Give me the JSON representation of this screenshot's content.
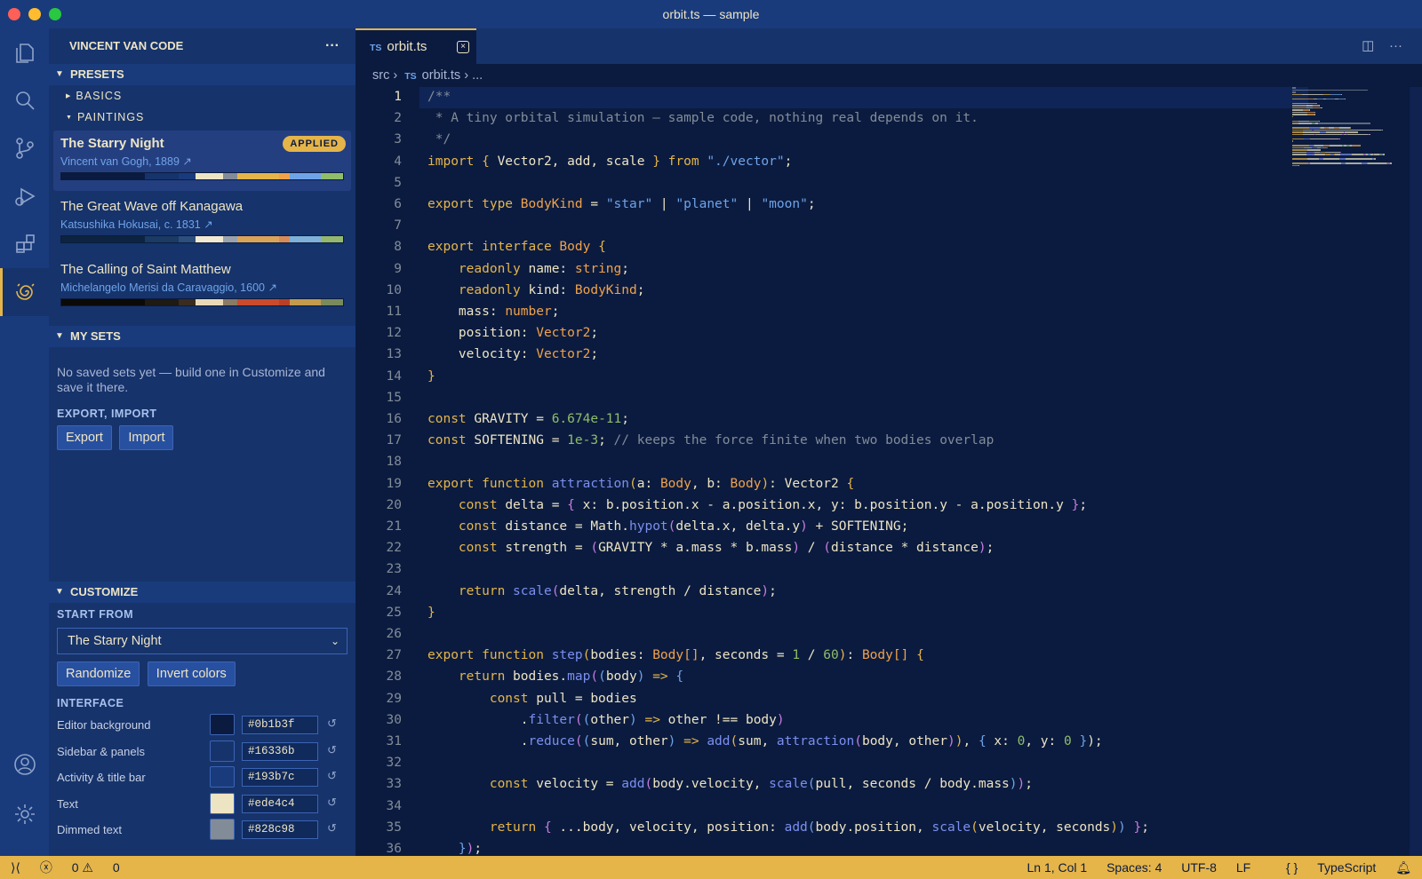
{
  "window": {
    "title": "orbit.ts — sample"
  },
  "sidebar": {
    "title": "VINCENT VAN CODE",
    "presets_label": "PRESETS",
    "basics_label": "BASICS",
    "paintings_label": "PAINTINGS",
    "paintings": [
      {
        "title": "The Starry Night",
        "artist": "Vincent van Gogh, 1889 ↗",
        "badge": "APPLIED",
        "colors": [
          "#0b1b3f",
          "#16336b",
          "#193b7c",
          "#ede4c4",
          "#828c98",
          "#e5b54a",
          "#f0a24a",
          "#6fa3e8",
          "#8fbd6a"
        ]
      },
      {
        "title": "The Great Wave off Kanagawa",
        "artist": "Katsushika Hokusai, c. 1831 ↗",
        "colors": [
          "#0d2440",
          "#1b3a64",
          "#2c4f7e",
          "#f1e9d2",
          "#9aa3ad",
          "#d9a35a",
          "#d88b5a",
          "#7fb0d8",
          "#94b86e"
        ]
      },
      {
        "title": "The Calling of Saint Matthew",
        "artist": "Michelangelo Merisi da Caravaggio, 1600 ↗",
        "colors": [
          "#0c0a08",
          "#1e1a14",
          "#3a2c1e",
          "#ead9b6",
          "#8a7b66",
          "#c94a2c",
          "#b84028",
          "#c49a4c",
          "#7a8a5c"
        ]
      }
    ],
    "mysets_label": "MY SETS",
    "mysets_empty": "No saved sets yet — build one in Customize and save it there.",
    "export_import_label": "EXPORT, IMPORT",
    "export_btn": "Export",
    "import_btn": "Import",
    "customize_label": "CUSTOMIZE",
    "start_from_label": "START FROM",
    "start_from_value": "The Starry Night",
    "randomize_btn": "Randomize",
    "invert_btn": "Invert colors",
    "interface_label": "INTERFACE",
    "colors": [
      {
        "name": "Editor background",
        "hex": "#0b1b3f"
      },
      {
        "name": "Sidebar & panels",
        "hex": "#16336b"
      },
      {
        "name": "Activity & title bar",
        "hex": "#193b7c"
      },
      {
        "name": "Text",
        "hex": "#ede4c4"
      },
      {
        "name": "Dimmed text",
        "hex": "#828c98"
      }
    ]
  },
  "editor": {
    "tab_label": "orbit.ts",
    "tab_lang": "TS",
    "crumb_src": "src",
    "crumb_file": "orbit.ts",
    "crumb_more": "...",
    "current_line": 1,
    "lines": [
      [
        [
          "/**",
          "cm"
        ]
      ],
      [
        [
          " * A tiny orbital simulation — sample code, nothing real depends on it.",
          "cm"
        ]
      ],
      [
        [
          " */",
          "cm"
        ]
      ],
      [
        [
          "import ",
          "kw"
        ],
        [
          "{ ",
          "br"
        ],
        [
          "Vector2, add, scale ",
          "tx"
        ],
        [
          "}",
          "br"
        ],
        [
          " from ",
          "kw"
        ],
        [
          "\"./vector\"",
          "st"
        ],
        [
          ";",
          "tx"
        ]
      ],
      [],
      [
        [
          "export ",
          "kw"
        ],
        [
          "type ",
          "kw"
        ],
        [
          "BodyKind",
          "ty"
        ],
        [
          " = ",
          "tx"
        ],
        [
          "\"star\"",
          "st"
        ],
        [
          " | ",
          "tx"
        ],
        [
          "\"planet\"",
          "st"
        ],
        [
          " | ",
          "tx"
        ],
        [
          "\"moon\"",
          "st"
        ],
        [
          ";",
          "tx"
        ]
      ],
      [],
      [
        [
          "export ",
          "kw"
        ],
        [
          "interface ",
          "kw"
        ],
        [
          "Body ",
          "ty"
        ],
        [
          "{",
          "br"
        ]
      ],
      [
        [
          "    readonly ",
          "kw"
        ],
        [
          "name: ",
          "tx"
        ],
        [
          "string",
          "ty"
        ],
        [
          ";",
          "tx"
        ]
      ],
      [
        [
          "    readonly ",
          "kw"
        ],
        [
          "kind: ",
          "tx"
        ],
        [
          "BodyKind",
          "ty"
        ],
        [
          ";",
          "tx"
        ]
      ],
      [
        [
          "    mass: ",
          "tx"
        ],
        [
          "number",
          "ty"
        ],
        [
          ";",
          "tx"
        ]
      ],
      [
        [
          "    position: ",
          "tx"
        ],
        [
          "Vector2",
          "ty"
        ],
        [
          ";",
          "tx"
        ]
      ],
      [
        [
          "    velocity: ",
          "tx"
        ],
        [
          "Vector2",
          "ty"
        ],
        [
          ";",
          "tx"
        ]
      ],
      [
        [
          "}",
          "br"
        ]
      ],
      [],
      [
        [
          "const ",
          "kw"
        ],
        [
          "GRAVITY = ",
          "tx"
        ],
        [
          "6.674e-11",
          "nm"
        ],
        [
          ";",
          "tx"
        ]
      ],
      [
        [
          "const ",
          "kw"
        ],
        [
          "SOFTENING = ",
          "tx"
        ],
        [
          "1e-3",
          "nm"
        ],
        [
          "; ",
          "tx"
        ],
        [
          "// keeps the force finite when two bodies overlap",
          "cm"
        ]
      ],
      [],
      [
        [
          "export ",
          "kw"
        ],
        [
          "function ",
          "kw"
        ],
        [
          "attraction",
          "fn"
        ],
        [
          "(",
          "br"
        ],
        [
          "a: ",
          "tx"
        ],
        [
          "Body",
          "ty"
        ],
        [
          ", b: ",
          "tx"
        ],
        [
          "Body",
          "ty"
        ],
        [
          ")",
          "br"
        ],
        [
          ": Vector2 ",
          "tx"
        ],
        [
          "{",
          "br"
        ]
      ],
      [
        [
          "    const ",
          "kw"
        ],
        [
          "delta = ",
          "tx"
        ],
        [
          "{ ",
          "br2"
        ],
        [
          "x: b.position.x - a.position.x, y: b.position.y - a.position.y ",
          "tx"
        ],
        [
          "}",
          "br2"
        ],
        [
          ";",
          "tx"
        ]
      ],
      [
        [
          "    const ",
          "kw"
        ],
        [
          "distance = Math.",
          "tx"
        ],
        [
          "hypot",
          "fn"
        ],
        [
          "(",
          "br2"
        ],
        [
          "delta.x, delta.y",
          "tx"
        ],
        [
          ")",
          "br2"
        ],
        [
          " + SOFTENING;",
          "tx"
        ]
      ],
      [
        [
          "    const ",
          "kw"
        ],
        [
          "strength = ",
          "tx"
        ],
        [
          "(",
          "br2"
        ],
        [
          "GRAVITY * a.mass * b.mass",
          "tx"
        ],
        [
          ")",
          "br2"
        ],
        [
          " / ",
          "tx"
        ],
        [
          "(",
          "br2"
        ],
        [
          "distance * distance",
          "tx"
        ],
        [
          ")",
          "br2"
        ],
        [
          ";",
          "tx"
        ]
      ],
      [],
      [
        [
          "    return ",
          "kw"
        ],
        [
          "scale",
          "fn"
        ],
        [
          "(",
          "br2"
        ],
        [
          "delta, strength / distance",
          "tx"
        ],
        [
          ")",
          "br2"
        ],
        [
          ";",
          "tx"
        ]
      ],
      [
        [
          "}",
          "br"
        ]
      ],
      [],
      [
        [
          "export ",
          "kw"
        ],
        [
          "function ",
          "kw"
        ],
        [
          "step",
          "fn"
        ],
        [
          "(",
          "br"
        ],
        [
          "bodies: ",
          "tx"
        ],
        [
          "Body[]",
          "ty"
        ],
        [
          ", seconds = ",
          "tx"
        ],
        [
          "1",
          "nm"
        ],
        [
          " / ",
          "tx"
        ],
        [
          "60",
          "nm"
        ],
        [
          ")",
          "br"
        ],
        [
          ": ",
          "tx"
        ],
        [
          "Body[] ",
          "ty"
        ],
        [
          "{",
          "br"
        ]
      ],
      [
        [
          "    return ",
          "kw"
        ],
        [
          "bodies.",
          "tx"
        ],
        [
          "map",
          "fn"
        ],
        [
          "(",
          "br2"
        ],
        [
          "(",
          "br3"
        ],
        [
          "body",
          "tx"
        ],
        [
          ")",
          "br3"
        ],
        [
          " => ",
          "kw"
        ],
        [
          "{",
          "br3"
        ]
      ],
      [
        [
          "        const ",
          "kw"
        ],
        [
          "pull = bodies",
          "tx"
        ]
      ],
      [
        [
          "            .",
          "tx"
        ],
        [
          "filter",
          "fn"
        ],
        [
          "(",
          "br2"
        ],
        [
          "(",
          "br3"
        ],
        [
          "other",
          "tx"
        ],
        [
          ")",
          "br3"
        ],
        [
          " => ",
          "kw"
        ],
        [
          "other !== body",
          "tx"
        ],
        [
          ")",
          "br2"
        ]
      ],
      [
        [
          "            .",
          "tx"
        ],
        [
          "reduce",
          "fn"
        ],
        [
          "(",
          "br2"
        ],
        [
          "(",
          "br3"
        ],
        [
          "sum, other",
          "tx"
        ],
        [
          ")",
          "br3"
        ],
        [
          " => ",
          "kw"
        ],
        [
          "add",
          "fn"
        ],
        [
          "(",
          "br"
        ],
        [
          "sum, ",
          "tx"
        ],
        [
          "attraction",
          "fn"
        ],
        [
          "(",
          "br2"
        ],
        [
          "body, other",
          "tx"
        ],
        [
          ")",
          "br2"
        ],
        [
          ")",
          "br"
        ],
        [
          ", ",
          "tx"
        ],
        [
          "{ ",
          "br3"
        ],
        [
          "x: ",
          "tx"
        ],
        [
          "0",
          "nm"
        ],
        [
          ", y: ",
          "tx"
        ],
        [
          "0",
          "nm"
        ],
        [
          " }",
          "br3"
        ],
        [
          ");",
          "tx"
        ]
      ],
      [],
      [
        [
          "        const ",
          "kw"
        ],
        [
          "velocity = ",
          "tx"
        ],
        [
          "add",
          "fn"
        ],
        [
          "(",
          "br2"
        ],
        [
          "body.velocity, ",
          "tx"
        ],
        [
          "scale",
          "fn"
        ],
        [
          "(",
          "br3"
        ],
        [
          "pull, seconds / body.mass",
          "tx"
        ],
        [
          ")",
          "br3"
        ],
        [
          ")",
          "br2"
        ],
        [
          ";",
          "tx"
        ]
      ],
      [],
      [
        [
          "        return ",
          "kw"
        ],
        [
          "{ ",
          "br2"
        ],
        [
          "...body, velocity, position: ",
          "tx"
        ],
        [
          "add",
          "fn"
        ],
        [
          "(",
          "br3"
        ],
        [
          "body.position, ",
          "tx"
        ],
        [
          "scale",
          "fn"
        ],
        [
          "(",
          "br"
        ],
        [
          "velocity, seconds",
          "tx"
        ],
        [
          ")",
          "br"
        ],
        [
          ")",
          "br3"
        ],
        [
          " }",
          "br2"
        ],
        [
          ";",
          "tx"
        ]
      ],
      [
        [
          "    }",
          "br3"
        ],
        [
          ")",
          "br2"
        ],
        [
          ";",
          "tx"
        ]
      ]
    ]
  },
  "syntax_colors": {
    "kw": "#e5b54a",
    "ty": "#f0a24a",
    "st": "#6fa3e8",
    "fn": "#7b8ff0",
    "nm": "#8fbd6a",
    "cm": "#828c98",
    "br": "#e5b54a",
    "br2": "#c77ce0",
    "br3": "#6fa3e8",
    "tx": "#ede4c4"
  },
  "statusbar": {
    "errors": "0",
    "warnings": "0",
    "position": "Ln 1, Col 1",
    "spaces": "Spaces: 4",
    "encoding": "UTF-8",
    "eol": "LF",
    "language": "TypeScript"
  }
}
